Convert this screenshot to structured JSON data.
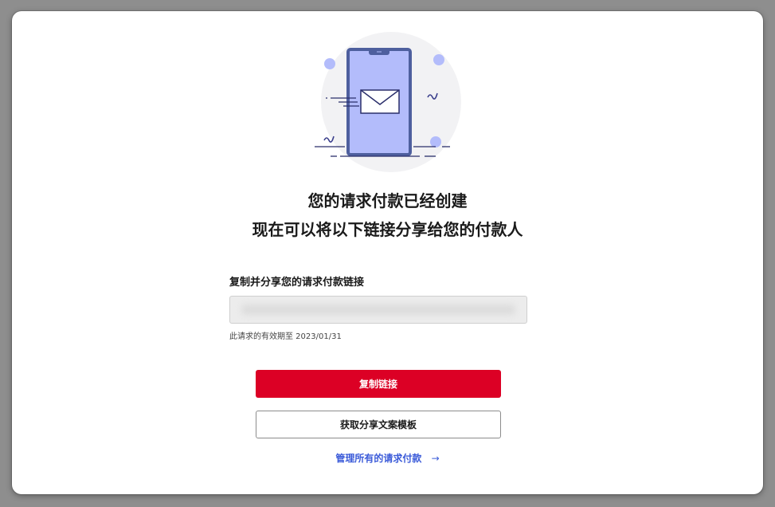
{
  "headline": {
    "line1": "您的请求付款已经创建",
    "line2": "现在可以将以下链接分享给您的付款人"
  },
  "copy_section": {
    "label": "复制并分享您的请求付款链接",
    "link_value": "",
    "expiry_text": "此请求的有效期至 2023/01/31"
  },
  "buttons": {
    "copy_link": "复制链接",
    "share_template": "获取分享文案模板"
  },
  "manage_link": {
    "label": "管理所有的请求付款",
    "arrow": "→"
  },
  "colors": {
    "primary_button": "#dc0025",
    "link": "#3b5bd9",
    "illustration_phone": "#b3bcfb",
    "illustration_frame": "#4e5f9e"
  },
  "icons": {
    "illustration": "phone-with-envelope-icon",
    "manage_arrow": "arrow-right-icon"
  }
}
